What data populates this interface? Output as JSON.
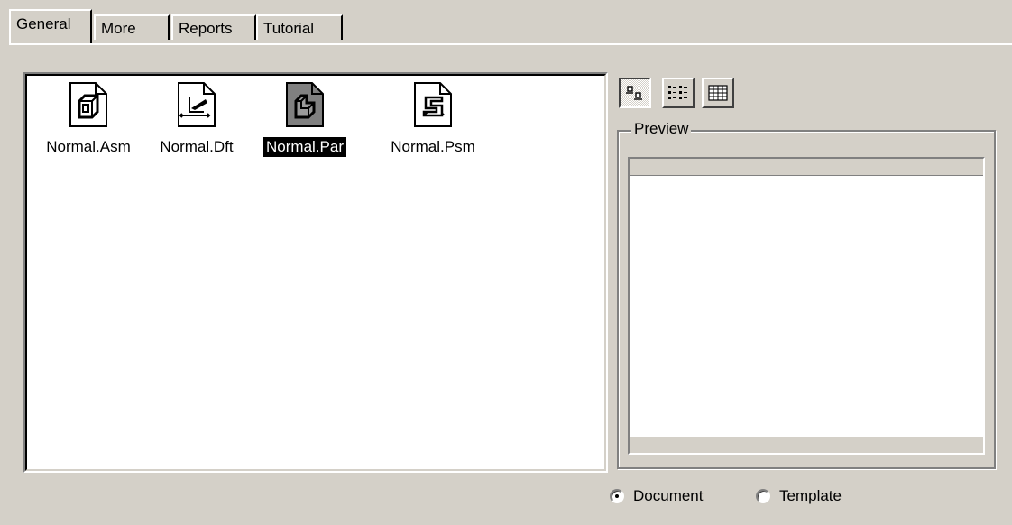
{
  "tabs": [
    {
      "label": "General",
      "active": true
    },
    {
      "label": "More",
      "active": false
    },
    {
      "label": "Reports",
      "active": false
    },
    {
      "label": "Tutorial",
      "active": false
    }
  ],
  "files": [
    {
      "name": "Normal.Asm",
      "icon": "assembly-document-icon",
      "selected": false
    },
    {
      "name": "Normal.Dft",
      "icon": "draft-document-icon",
      "selected": false
    },
    {
      "name": "Normal.Par",
      "icon": "part-document-icon",
      "selected": true
    },
    {
      "name": "Normal.Psm",
      "icon": "sheetmetal-document-icon",
      "selected": false
    }
  ],
  "view_buttons": [
    {
      "icon": "large-icons-view-icon",
      "pressed": true
    },
    {
      "icon": "list-view-icon",
      "pressed": false
    },
    {
      "icon": "details-view-icon",
      "pressed": false
    }
  ],
  "preview": {
    "label": "Preview"
  },
  "radios": {
    "document": {
      "mnemonic": "D",
      "rest": "ocument",
      "checked": true
    },
    "template": {
      "mnemonic": "T",
      "rest": "emplate",
      "checked": false
    }
  },
  "colors": {
    "face": "#d4d0c8",
    "selection": "#000000"
  }
}
